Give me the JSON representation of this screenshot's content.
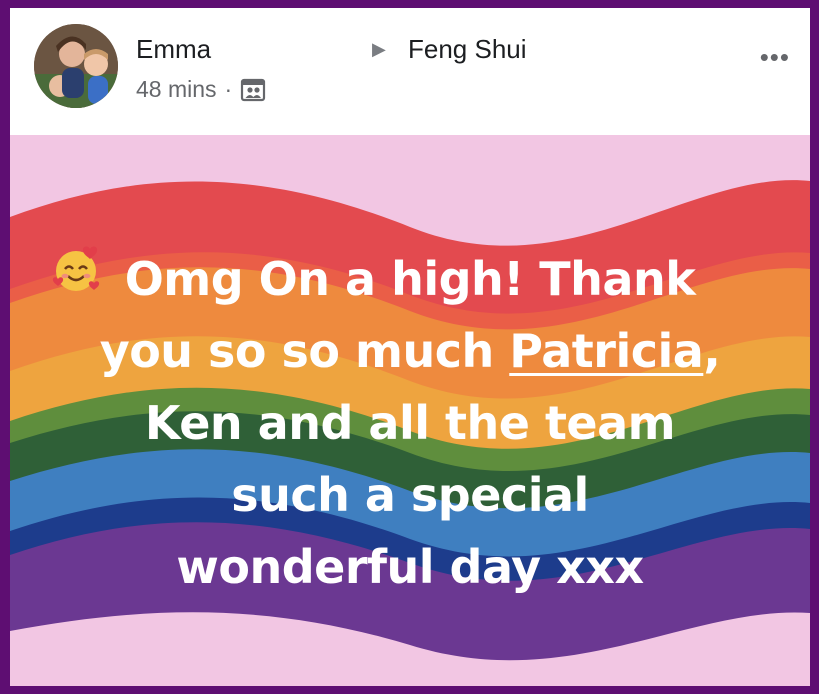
{
  "post": {
    "author": "Emma",
    "group": "Feng Shui",
    "time": "48 mins",
    "separator": "·",
    "more_label": "•••",
    "arrow": "▶",
    "audience_icon": "group-audience-icon",
    "avatar_icon": "profile-photo"
  },
  "content": {
    "line1": "Omg On a high! Thank",
    "line2_pre": "you so so much ",
    "mention": "Patricia",
    "line2_post": ",",
    "line3": "Ken and all the team",
    "emoji": "smiling-face-with-hearts-icon",
    "line4": "such a special",
    "line5": "wonderful day xxx"
  },
  "colors": {
    "frame": "#5e0e72",
    "background": "#f2c6e3",
    "red": "#e34a4f",
    "orange": "#ee8a3e",
    "yellow": "#eea43f",
    "green": "#5f8e3d",
    "darkgreen": "#2f6037",
    "blue": "#3f7fc0",
    "navy": "#1d3c8c",
    "purple": "#6b3892"
  }
}
